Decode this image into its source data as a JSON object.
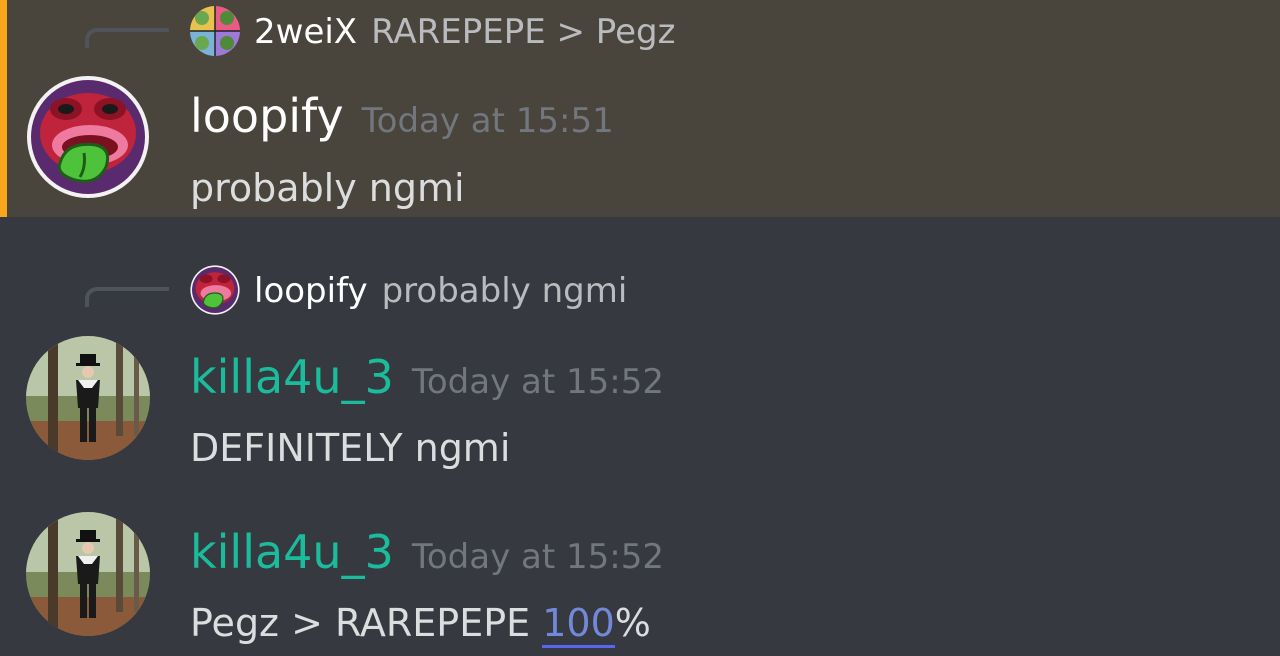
{
  "messages": [
    {
      "reply": {
        "author": "2weiX",
        "content": "RAREPEPE > Pegz",
        "avatar_icon": "pepe-grid-avatar-icon"
      },
      "author": "loopify",
      "timestamp": "Today at 15:51",
      "content": "probably ngmi",
      "avatar_icon": "pepe-tongue-avatar-icon",
      "highlighted": true
    },
    {
      "reply": {
        "author": "loopify",
        "content": "probably ngmi",
        "avatar_icon": "pepe-tongue-avatar-icon"
      },
      "author": "killa4u_3",
      "timestamp": "Today at 15:52",
      "content": "DEFINITELY ngmi",
      "avatar_icon": "pilgrim-photo-avatar-icon"
    },
    {
      "author": "killa4u_3",
      "timestamp": "Today at 15:52",
      "content_before": "Pegz > RAREPEPE ",
      "content_accent": "100",
      "content_after": "%",
      "avatar_icon": "pilgrim-photo-avatar-icon"
    }
  ],
  "colors": {
    "background": "#36393f",
    "highlight_background": "#49443c",
    "highlight_bar": "#faa61a",
    "author_green": "#1abc9c",
    "timestamp": "#72767d",
    "accent_link": "#7289da"
  }
}
